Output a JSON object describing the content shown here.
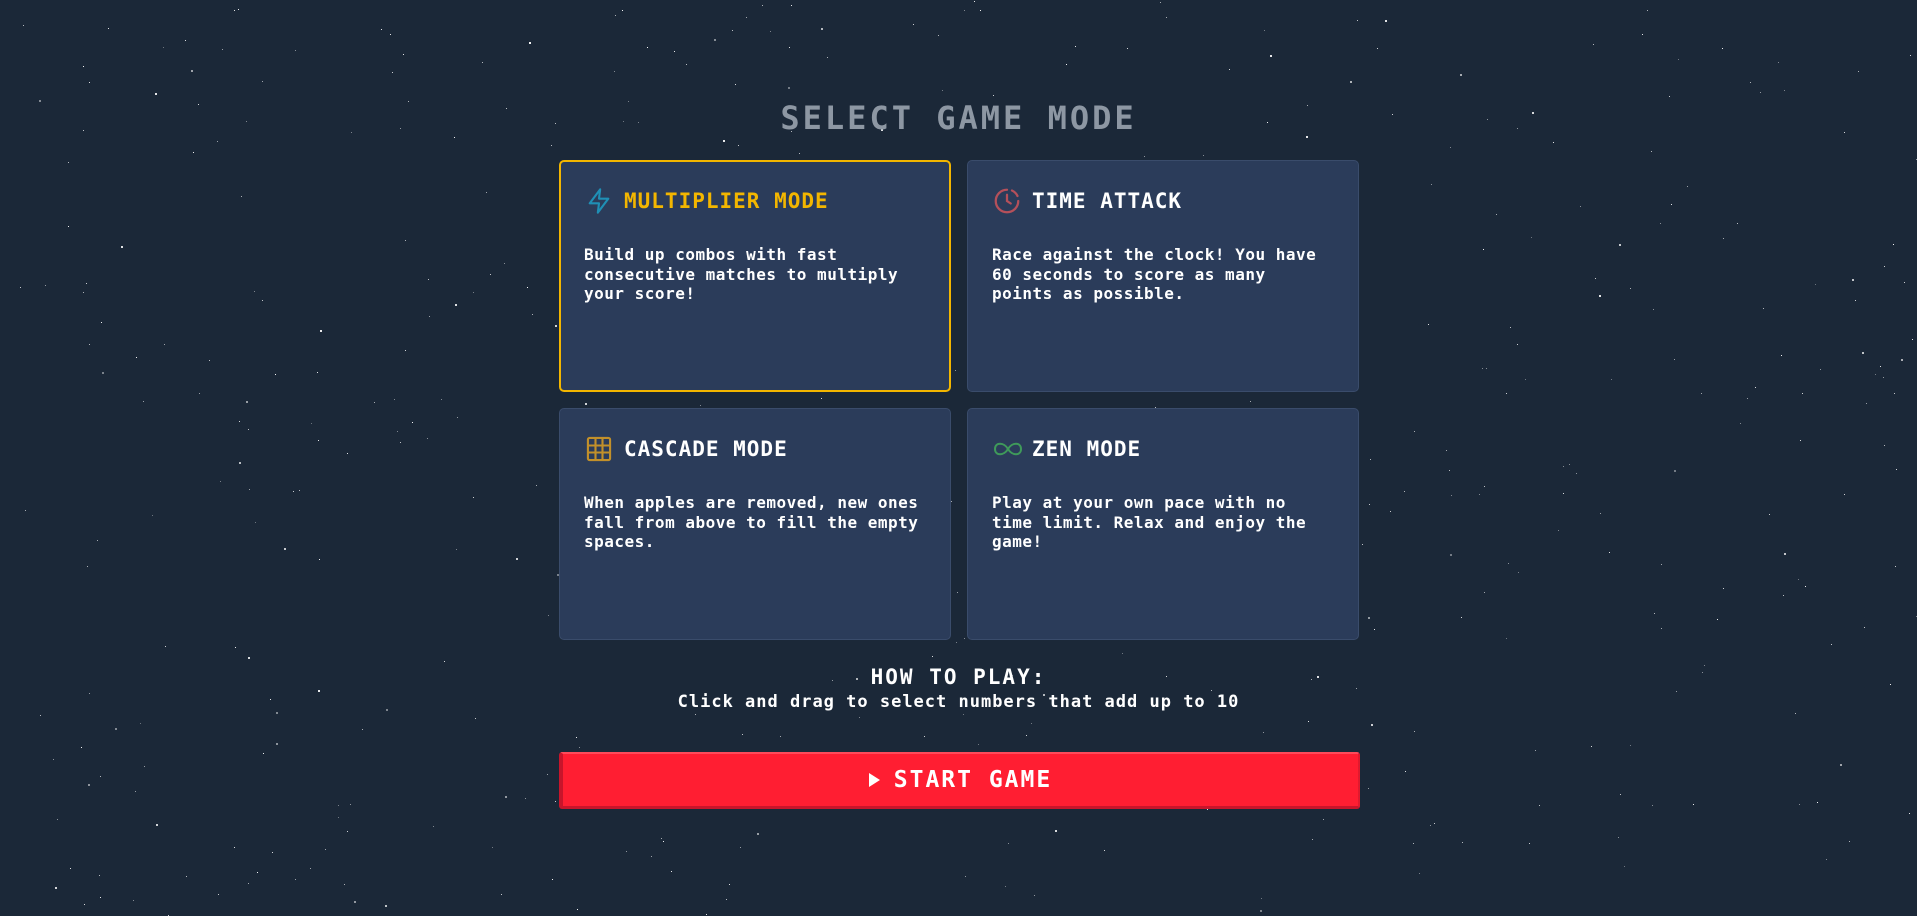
{
  "page": {
    "title": "SELECT GAME MODE"
  },
  "modes": [
    {
      "title": "MULTIPLIER MODE",
      "description": "Build up combos with fast consecutive matches to multiply your score!",
      "icon": "lightning-icon",
      "icon_color": "#1f8fb5",
      "selected": true
    },
    {
      "title": "TIME ATTACK",
      "description": "Race against the clock! You have 60 seconds to score as many points as possible.",
      "icon": "clock-icon",
      "icon_color": "#b5505a",
      "selected": false
    },
    {
      "title": "CASCADE MODE",
      "description": "When apples are removed, new ones fall from above to fill the empty spaces.",
      "icon": "grid-icon",
      "icon_color": "#c2902a",
      "selected": false
    },
    {
      "title": "ZEN MODE",
      "description": "Play at your own pace with no time limit. Relax and enjoy the game!",
      "icon": "infinity-icon",
      "icon_color": "#3f9a5a",
      "selected": false
    }
  ],
  "how_to_play": {
    "title": "HOW TO PLAY:",
    "text": "Click and drag to select numbers that add up to 10"
  },
  "start_button": {
    "label": "START GAME",
    "icon": "play-icon"
  },
  "colors": {
    "background": "#1b2838",
    "card": "#2b3c5a",
    "selected_border": "#f3b600",
    "start_button": "#ff1e32"
  }
}
